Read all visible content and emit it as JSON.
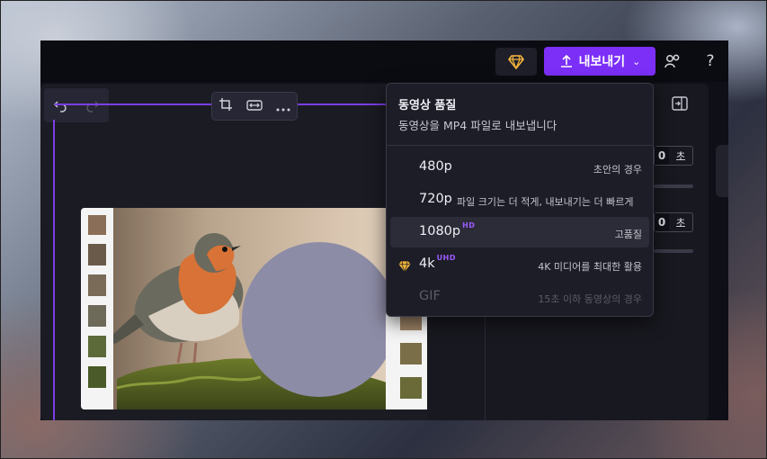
{
  "topbar": {
    "export_label": "내보내기",
    "help_label": "?"
  },
  "export_menu": {
    "title": "동영상 품질",
    "subtitle": "동영상을 MP4 파일로 내보냅니다",
    "options": [
      {
        "name": "480p",
        "badge": "",
        "desc": "초안의 경우",
        "state": "normal"
      },
      {
        "name": "720p",
        "badge": "",
        "desc": "파일 크기는 더 적게, 내보내기는 더 빠르게",
        "state": "normal"
      },
      {
        "name": "1080p",
        "badge": "HD",
        "desc": "고품질",
        "state": "selected"
      },
      {
        "name": "4k",
        "badge": "UHD",
        "desc": "4K 미디어를 최대한 활용",
        "state": "premium"
      },
      {
        "name": "GIF",
        "badge": "",
        "desc": "15초 이하 동영상의 경우",
        "state": "disabled"
      }
    ]
  },
  "right_panel": {
    "field1": {
      "value": "0",
      "unit": "초"
    },
    "field2": {
      "value": "0",
      "unit": "초"
    }
  },
  "colors": {
    "accent": "#7b2ff7",
    "premium_gem": "#f5b73b"
  }
}
